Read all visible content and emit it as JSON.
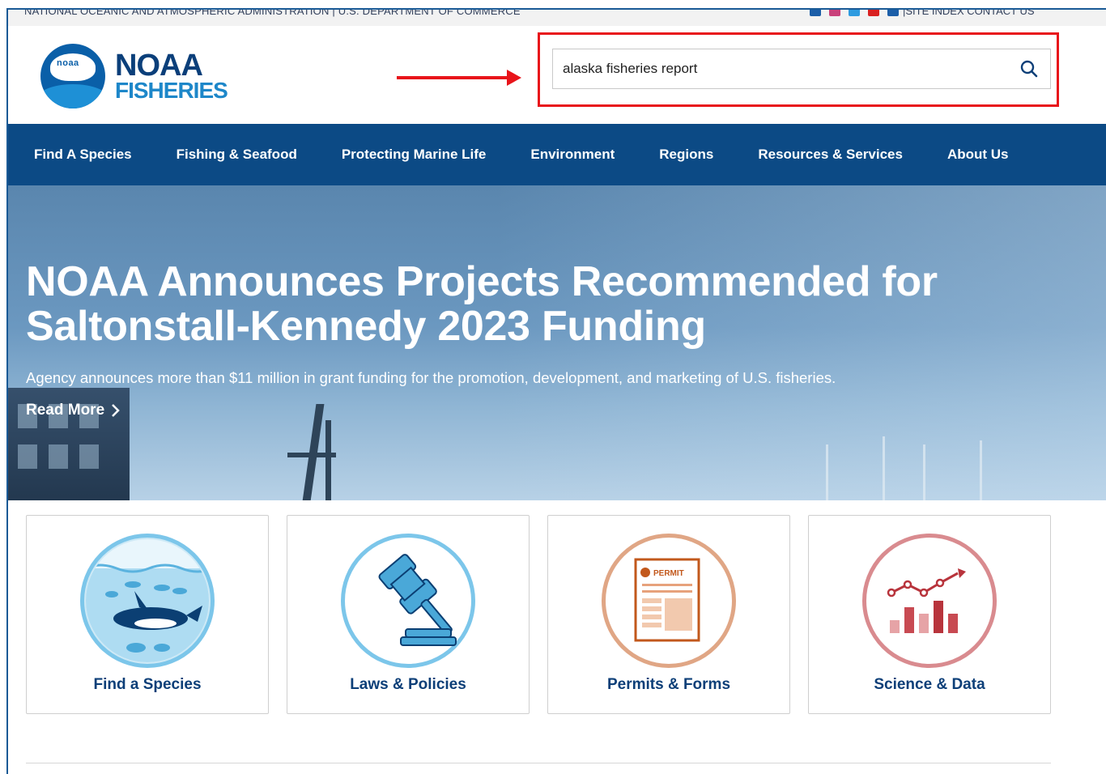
{
  "utility": {
    "agency_text": "NATIONAL OCEANIC AND ATMOSPHERIC ADMINISTRATION | U.S. DEPARTMENT OF COMMERCE",
    "links_text": "|SITE INDEX  CONTACT US",
    "social_icons": [
      "facebook-icon",
      "instagram-icon",
      "twitter-icon",
      "youtube-icon",
      "email-icon"
    ]
  },
  "logo": {
    "line1": "NOAA",
    "line2": "FISHERIES",
    "badge": "noaa"
  },
  "search": {
    "value": "alaska fisheries report",
    "icon": "search-icon"
  },
  "nav": {
    "items": [
      "Find A Species",
      "Fishing & Seafood",
      "Protecting Marine Life",
      "Environment",
      "Regions",
      "Resources & Services",
      "About Us"
    ]
  },
  "hero": {
    "title": "NOAA Announces Projects Recommended for Saltonstall-Kennedy 2023 Funding",
    "subtitle": "Agency announces more than $11 million in grant funding for the promotion, development, and marketing of U.S. fisheries.",
    "cta": "Read More"
  },
  "cards": [
    {
      "label": "Find a Species",
      "icon": "fish-icon",
      "color": "#7cc6ea"
    },
    {
      "label": "Laws & Policies",
      "icon": "gavel-icon",
      "color": "#7cc6ea"
    },
    {
      "label": "Permits & Forms",
      "icon": "permit-icon",
      "color": "#e0a685",
      "badge": "PERMIT"
    },
    {
      "label": "Science & Data",
      "icon": "chart-icon",
      "color": "#d98b8f"
    }
  ],
  "colors": {
    "nav_bg": "#0c4a85",
    "highlight": "#e8141a",
    "card_label": "#0d3f78"
  }
}
